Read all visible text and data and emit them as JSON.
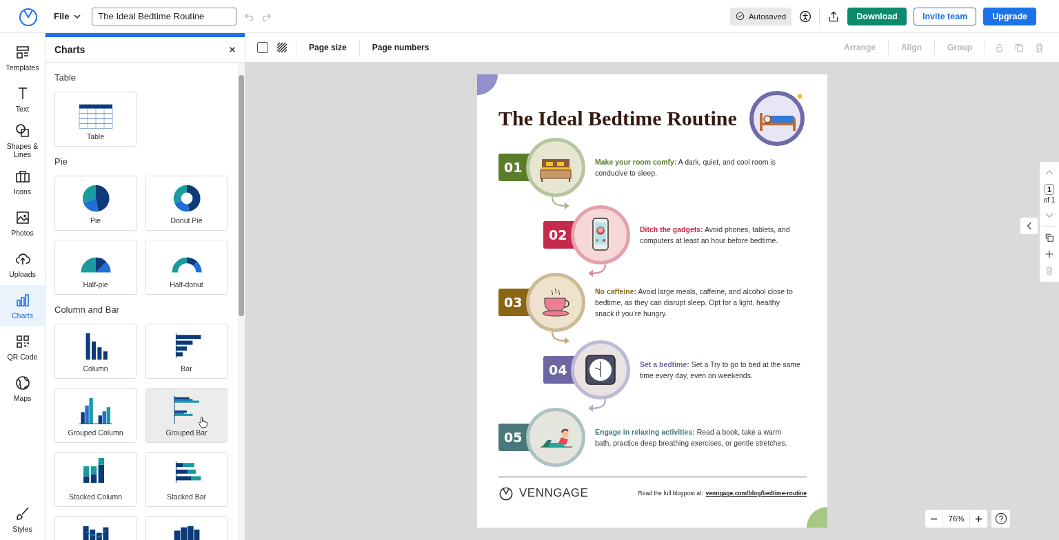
{
  "app_bar": {
    "file_menu": "File",
    "document_title": "The Ideal Bedtime Routine",
    "status": "Autosaved",
    "buttons": [
      {
        "label": "Download",
        "kind": "primary"
      },
      {
        "label": "Invite team",
        "kind": "outline"
      },
      {
        "label": "Upgrade",
        "kind": "accent"
      }
    ]
  },
  "sidebar": {
    "items": [
      {
        "label": "Templates",
        "selected": false
      },
      {
        "label": "Text",
        "selected": false
      },
      {
        "label": "Shapes & Lines",
        "selected": false
      },
      {
        "label": "Icons",
        "selected": false
      },
      {
        "label": "Photos",
        "selected": false
      },
      {
        "label": "Uploads",
        "selected": false
      },
      {
        "label": "Charts",
        "selected": true
      },
      {
        "label": "QR Code",
        "selected": false
      },
      {
        "label": "Maps",
        "selected": false
      },
      {
        "label": "Styles",
        "selected": false
      }
    ]
  },
  "panel": {
    "title": "Charts",
    "sections": [
      {
        "heading": "Table",
        "items": [
          {
            "label": "Table",
            "hovered": false
          }
        ]
      },
      {
        "heading": "Pie",
        "items": [
          {
            "label": "Pie",
            "hovered": false
          },
          {
            "label": "Donut Pie",
            "hovered": false
          },
          {
            "label": "Half-pie",
            "hovered": false
          },
          {
            "label": "Half-donut",
            "hovered": false
          }
        ]
      },
      {
        "heading": "Column and Bar",
        "items": [
          {
            "label": "Column",
            "hovered": false
          },
          {
            "label": "Bar",
            "hovered": false
          },
          {
            "label": "Grouped Column",
            "hovered": false
          },
          {
            "label": "Grouped Bar",
            "hovered": true
          },
          {
            "label": "Stacked Column",
            "hovered": false
          },
          {
            "label": "Stacked Bar",
            "hovered": false
          },
          {
            "hovered": false
          },
          {
            "hovered": false
          }
        ]
      }
    ]
  },
  "toolbar": {
    "select_all_checked": false,
    "left": [
      {
        "label": "Page size"
      },
      {
        "label": "Page numbers"
      }
    ],
    "right": [
      {
        "label": "Arrange",
        "disabled": true
      },
      {
        "label": "Align",
        "disabled": true
      },
      {
        "label": "Group",
        "disabled": true
      }
    ]
  },
  "infographic": {
    "title": "The Ideal Bedtime Routine",
    "steps": [
      {
        "number": "01",
        "text": "**Make your room comfy:** A dark, quiet, and cool room is conducive to sleep.",
        "color": "#5b7d2b"
      },
      {
        "number": "02",
        "text": "**Ditch the gadgets:** Avoid phones, tablets, and computers at least an hour before bedtime.",
        "color": "#c52a4b"
      },
      {
        "number": "03",
        "text": "**No caffeine:** Avoid large meals, caffeine, and alcohol close to bedtime, as they can disrupt sleep. Opt for a light, healthy snack if you’re hungry.",
        "color": "#8c6514"
      },
      {
        "number": "04",
        "text": "**Set a bedtime:** Set a Try to go to bed at the same time every day, even on weekends.",
        "color": "#6c66a2"
      },
      {
        "number": "05",
        "text": "**Engage in relaxing activities:** Read a book, take a warm bath, practice deep breathing exercises, or gentle stretches.",
        "color": "#4a787a"
      }
    ],
    "footer": {
      "brand": "VENNGAGE",
      "prefix": "Read the full blogpost at:",
      "link": "venngage.com/blog/bedtime-routine"
    }
  },
  "page_nav": {
    "page": "1",
    "total": "of 1"
  },
  "zoom": {
    "value": "76%"
  }
}
